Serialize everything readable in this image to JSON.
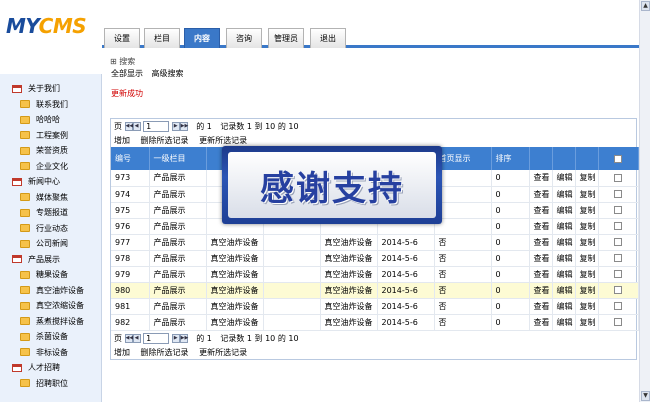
{
  "header": {
    "logo_main": "MY",
    "logo_accent": "CMS",
    "tabs": [
      {
        "label": "设置",
        "active": false
      },
      {
        "label": "栏目",
        "active": false
      },
      {
        "label": "内容",
        "active": true
      },
      {
        "label": "咨询",
        "active": false
      },
      {
        "label": "管理员",
        "active": false
      },
      {
        "label": "退出",
        "active": false
      }
    ]
  },
  "sidebar": {
    "items": [
      {
        "label": "关于我们",
        "level": 0
      },
      {
        "label": "联系我们",
        "level": 1
      },
      {
        "label": "哈哈哈",
        "level": 1
      },
      {
        "label": "工程案例",
        "level": 1
      },
      {
        "label": "荣誉资质",
        "level": 1
      },
      {
        "label": "企业文化",
        "level": 1
      },
      {
        "label": "新闻中心",
        "level": 0
      },
      {
        "label": "媒体聚焦",
        "level": 1
      },
      {
        "label": "专题报道",
        "level": 1
      },
      {
        "label": "行业动态",
        "level": 1
      },
      {
        "label": "公司新闻",
        "level": 1
      },
      {
        "label": "产品展示",
        "level": 0
      },
      {
        "label": "糖果设备",
        "level": 1
      },
      {
        "label": "真空油炸设备",
        "level": 1
      },
      {
        "label": "真空浓缩设备",
        "level": 1
      },
      {
        "label": "蒸煮搅拌设备",
        "level": 1
      },
      {
        "label": "杀菌设备",
        "level": 1
      },
      {
        "label": "非标设备",
        "level": 1
      },
      {
        "label": "人才招聘",
        "level": 0
      },
      {
        "label": "招聘职位",
        "level": 1
      }
    ]
  },
  "main": {
    "search_toggle": "⊞ 搜索",
    "show_all": "全部显示",
    "advanced_search": "高级搜索",
    "success_message": "更新成功",
    "pager": {
      "page_label": "页",
      "current_page": "1",
      "of_text": "的 1",
      "records_text": "记录数 1 到 10 的 10"
    },
    "actions": {
      "add": "增加",
      "delete_selected": "删除所选记录",
      "update_selected": "更新所选记录"
    },
    "columns": [
      "编号",
      "一级栏目",
      "",
      "",
      "",
      "",
      "首页显示",
      "排序",
      "",
      "",
      "",
      ""
    ],
    "rows": [
      {
        "id": "973",
        "category": "产品展示",
        "sub": "",
        "sub2": "",
        "date": "",
        "home": "",
        "order": "0",
        "highlight": false
      },
      {
        "id": "974",
        "category": "产品展示",
        "sub": "",
        "sub2": "",
        "date": "",
        "home": "",
        "order": "0",
        "highlight": false
      },
      {
        "id": "975",
        "category": "产品展示",
        "sub": "",
        "sub2": "",
        "date": "",
        "home": "",
        "order": "0",
        "highlight": false
      },
      {
        "id": "976",
        "category": "产品展示",
        "sub": "",
        "sub2": "",
        "date": "",
        "home": "",
        "order": "0",
        "highlight": false
      },
      {
        "id": "977",
        "category": "产品展示",
        "sub": "真空油炸设备",
        "sub2": "真空油炸设备",
        "date": "2014-5-6",
        "home": "否",
        "order": "0",
        "highlight": false
      },
      {
        "id": "978",
        "category": "产品展示",
        "sub": "真空油炸设备",
        "sub2": "真空油炸设备",
        "date": "2014-5-6",
        "home": "否",
        "order": "0",
        "highlight": false
      },
      {
        "id": "979",
        "category": "产品展示",
        "sub": "真空油炸设备",
        "sub2": "真空油炸设备",
        "date": "2014-5-6",
        "home": "否",
        "order": "0",
        "highlight": false
      },
      {
        "id": "980",
        "category": "产品展示",
        "sub": "真空油炸设备",
        "sub2": "真空油炸设备",
        "date": "2014-5-6",
        "home": "否",
        "order": "0",
        "highlight": true
      },
      {
        "id": "981",
        "category": "产品展示",
        "sub": "真空油炸设备",
        "sub2": "真空油炸设备",
        "date": "2014-5-6",
        "home": "否",
        "order": "0",
        "highlight": false
      },
      {
        "id": "982",
        "category": "产品展示",
        "sub": "真空油炸设备",
        "sub2": "真空油炸设备",
        "date": "2014-5-6",
        "home": "否",
        "order": "0",
        "highlight": false
      }
    ],
    "row_actions": {
      "view": "查看",
      "edit": "编辑",
      "copy": "复制"
    }
  },
  "overlay": {
    "text": "感谢支持"
  },
  "colors": {
    "accent": "#3a78c8",
    "header_row": "#3d7fd0",
    "highlight_row": "#fdfbd4",
    "success": "#d10000",
    "sidebar_bg": "#eaf1fb"
  }
}
